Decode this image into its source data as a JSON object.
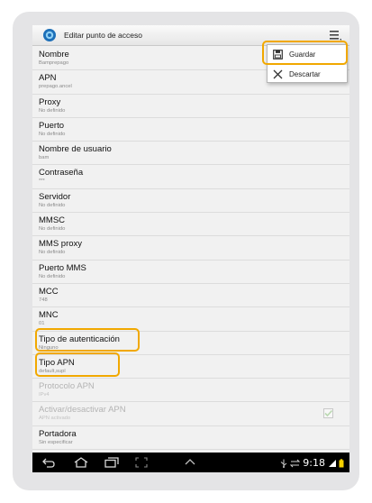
{
  "actionbar": {
    "title": "Editar punto de acceso",
    "menu_icon": "overflow-menu-icon"
  },
  "menu": {
    "items": [
      {
        "label": "Guardar",
        "icon": "save-icon"
      },
      {
        "label": "Descartar",
        "icon": "close-icon"
      }
    ]
  },
  "fields": [
    {
      "label": "Nombre",
      "value": "Bamprepago"
    },
    {
      "label": "APN",
      "value": "prepago.ancel"
    },
    {
      "label": "Proxy",
      "value": "No definido"
    },
    {
      "label": "Puerto",
      "value": "No definido"
    },
    {
      "label": "Nombre de usuario",
      "value": "bam"
    },
    {
      "label": "Contraseña",
      "value": "***"
    },
    {
      "label": "Servidor",
      "value": "No definido"
    },
    {
      "label": "MMSC",
      "value": "No definido"
    },
    {
      "label": "MMS proxy",
      "value": "No definido"
    },
    {
      "label": "Puerto MMS",
      "value": "No definido"
    },
    {
      "label": "MCC",
      "value": "748"
    },
    {
      "label": "MNC",
      "value": "01"
    },
    {
      "label": "Tipo de autenticación",
      "value": "Ninguno"
    },
    {
      "label": "Tipo APN",
      "value": "default,supl"
    },
    {
      "label": "Protocolo APN",
      "value": "IPv4",
      "disabled": true
    },
    {
      "label": "Activar/desactivar APN",
      "value": "APN activado",
      "disabled": true,
      "checked": true
    },
    {
      "label": "Portadora",
      "value": "Sin especificar"
    }
  ],
  "statusbar": {
    "time": "9:18"
  },
  "colors": {
    "highlight": "#f1a800",
    "navbar": "#000000"
  }
}
